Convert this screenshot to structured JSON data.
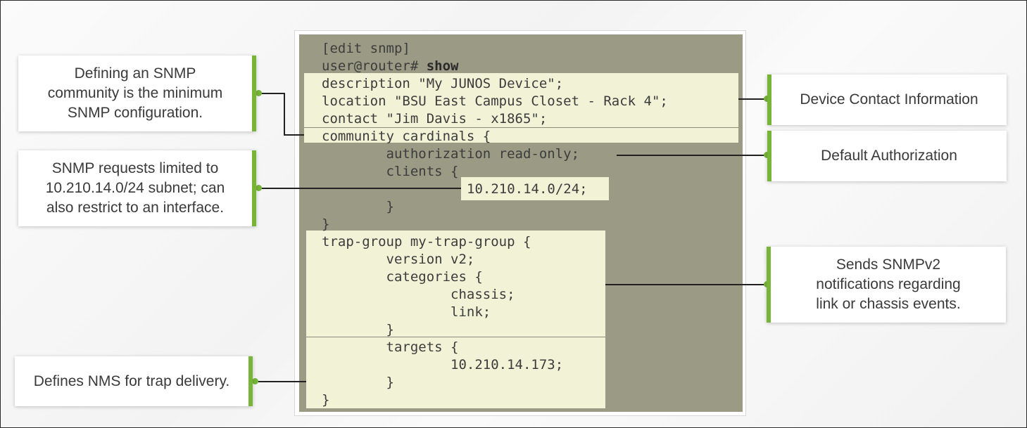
{
  "code": {
    "line1": "[edit snmp]",
    "prompt": "user@router# ",
    "command": "show",
    "line3": "description \"My JUNOS Device\";",
    "line4": "location \"BSU East Campus Closet - Rack 4\";",
    "line5": "contact \"Jim Davis - x1865\";",
    "line6": "community cardinals {",
    "line7": "        authorization read-only;",
    "line8": "        clients {",
    "line9": "10.210.14.0/24;",
    "line10": "        }",
    "line11": "}",
    "line12": "trap-group my-trap-group {",
    "line13": "        version v2;",
    "line14": "        categories {",
    "line15": "                chassis;",
    "line16": "                link;",
    "line17": "        }",
    "line18": "        targets {",
    "line19": "                10.210.14.173;",
    "line20": "        }",
    "line21": "}"
  },
  "callouts": {
    "community": "Defining an SNMP\ncommunity is the minimum\nSNMP configuration.",
    "clients": "SNMP requests limited to\n10.210.14.0/24 subnet; can\nalso restrict to an interface.",
    "targets": "Defines NMS for trap delivery.",
    "contact": "Device Contact Information",
    "authorization": "Default Authorization",
    "trap": "Sends SNMPv2\nnotifications regarding\nlink or chassis events."
  },
  "colors": {
    "accent": "#77b539",
    "panel": "#9a9a85",
    "highlight": "#f2f2d7"
  }
}
